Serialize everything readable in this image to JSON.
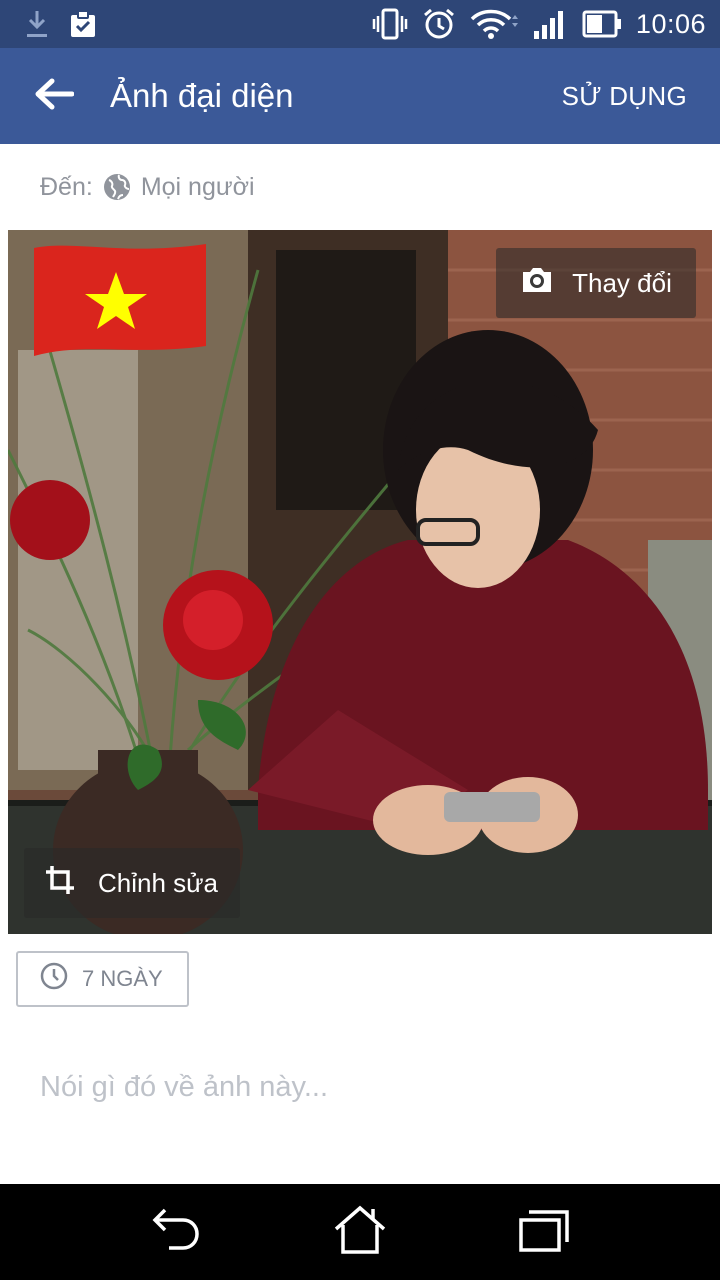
{
  "status_bar": {
    "time": "10:06",
    "icons": [
      "download-icon",
      "clipboard-check-icon",
      "vibrate-icon",
      "alarm-icon",
      "wifi-icon",
      "signal-icon",
      "battery-icon"
    ]
  },
  "app_bar": {
    "title": "Ảnh đại diện",
    "action_label": "SỬ DỤNG",
    "back_icon": "arrow-left-icon"
  },
  "audience": {
    "prefix": "Đến:",
    "value": "Mọi người",
    "icon": "globe-icon"
  },
  "photo": {
    "change_label": "Thay đổi",
    "change_icon": "camera-icon",
    "edit_label": "Chỉnh sửa",
    "edit_icon": "crop-icon",
    "overlay": "vietnam-flag"
  },
  "timer": {
    "label": "7 NGÀY",
    "icon": "clock-icon"
  },
  "caption": {
    "placeholder": "Nói gì đó về ảnh này..."
  },
  "nav_bar": {
    "buttons": [
      "back-icon",
      "home-icon",
      "recent-apps-icon"
    ]
  },
  "colors": {
    "status_bar": "#2e4677",
    "app_bar": "#3b5998",
    "muted_text": "#90949c",
    "placeholder": "#bec2c9",
    "flag_red": "#da251d",
    "flag_star": "#ffff00"
  }
}
